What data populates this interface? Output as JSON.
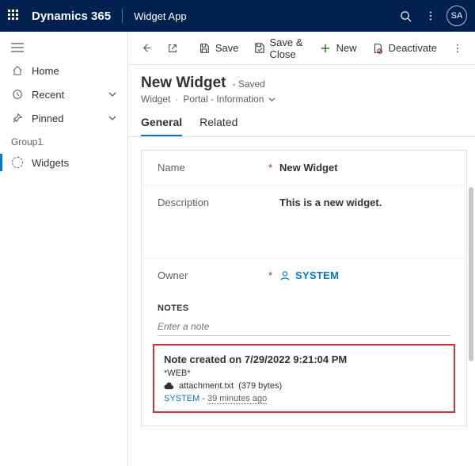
{
  "topbar": {
    "brand": "Dynamics 365",
    "app": "Widget App",
    "avatar": "SA"
  },
  "sidebar": {
    "home": "Home",
    "recent": "Recent",
    "pinned": "Pinned",
    "group": "Group1",
    "widgets": "Widgets"
  },
  "commands": {
    "save": "Save",
    "saveclose": "Save & Close",
    "new": "New",
    "deactivate": "Deactivate"
  },
  "header": {
    "title": "New Widget",
    "state": "- Saved",
    "entity": "Widget",
    "form": "Portal - Information"
  },
  "tabs": {
    "general": "General",
    "related": "Related"
  },
  "form": {
    "name_label": "Name",
    "name_value": "New Widget",
    "desc_label": "Description",
    "desc_value": "This is a new widget.",
    "owner_label": "Owner",
    "owner_value": "SYSTEM",
    "notes_header": "NOTES",
    "note_placeholder": "Enter a note"
  },
  "note": {
    "title": "Note created on 7/29/2022 9:21:04 PM",
    "tag": "*WEB*",
    "attachment_name": "attachment.txt",
    "attachment_size": "(379 bytes)",
    "author": "SYSTEM",
    "sep": " - ",
    "ago": "39 minutes ago"
  }
}
